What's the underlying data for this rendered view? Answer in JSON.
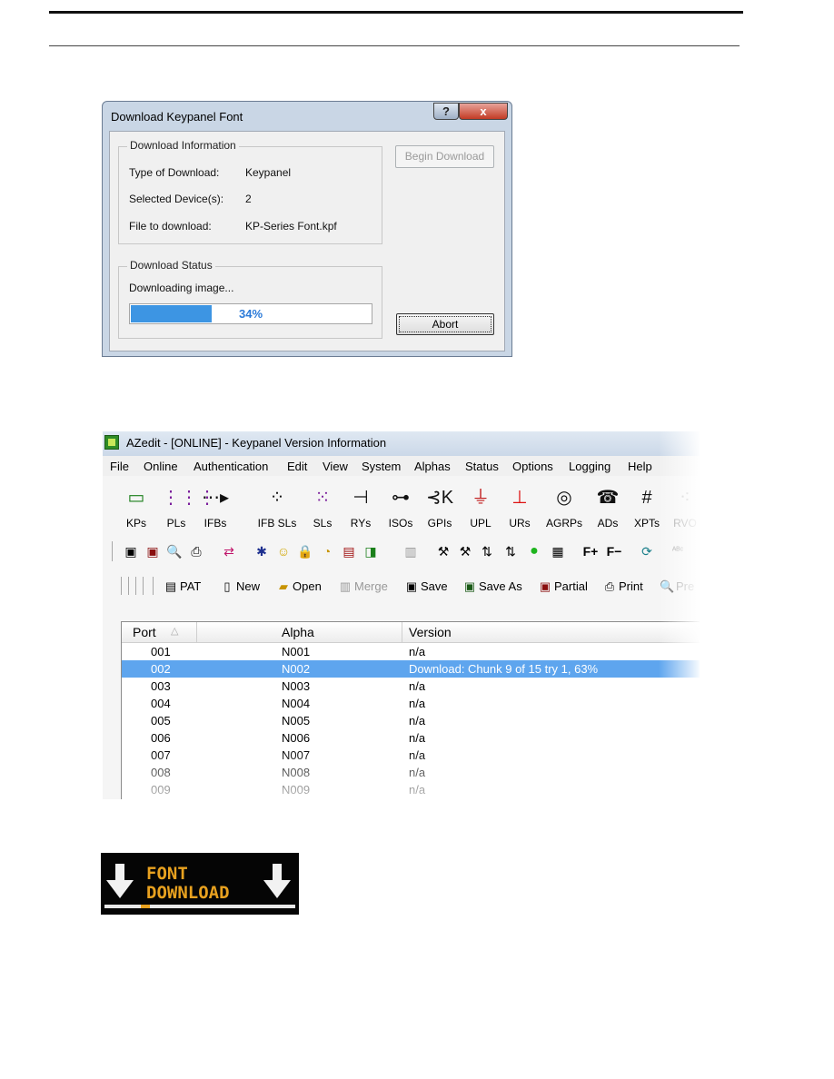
{
  "dialog": {
    "title": "Download Keypanel Font",
    "help_button": "?",
    "close_button": "x",
    "info_group": "Download Information",
    "type_label": "Type of Download:",
    "type_value": "Keypanel",
    "devices_label": "Selected Device(s):",
    "devices_value": "2",
    "file_label": "File to download:",
    "file_value": "KP-Series Font.kpf",
    "begin_button": "Begin Download",
    "status_group": "Download Status",
    "status_text": "Downloading image...",
    "progress_percent": 34,
    "progress_text": "34%",
    "abort_button": "Abort",
    "colors": {
      "progress": "#3d95e3",
      "titlebar": "#c9d6e5"
    }
  },
  "azedit": {
    "title": "AZedit - [ONLINE] - Keypanel Version Information",
    "menu": [
      "File",
      "Online",
      "Authentication",
      "Edit",
      "View",
      "System",
      "Alphas",
      "Status",
      "Options",
      "Logging",
      "Help"
    ],
    "toolbar_main": [
      {
        "label": "KPs",
        "icon": "keypanel-icon"
      },
      {
        "label": "PLs",
        "icon": "party-line-icon"
      },
      {
        "label": "IFBs",
        "icon": "ifb-icon"
      },
      {
        "label": "IFB SLs",
        "icon": "ifb-sl-icon"
      },
      {
        "label": "SLs",
        "icon": "special-list-icon"
      },
      {
        "label": "RYs",
        "icon": "relay-icon"
      },
      {
        "label": "ISOs",
        "icon": "iso-icon"
      },
      {
        "label": "GPIs",
        "icon": "gpi-icon"
      },
      {
        "label": "UPL",
        "icon": "upl-icon"
      },
      {
        "label": "URs",
        "icon": "ur-icon"
      },
      {
        "label": "AGRPs",
        "icon": "agrp-icon"
      },
      {
        "label": "ADs",
        "icon": "ad-icon"
      },
      {
        "label": "XPTs",
        "icon": "crosspoint-icon"
      },
      {
        "label": "RVO",
        "icon": "rvo-icon"
      }
    ],
    "toolbar_file": [
      {
        "label": "PAT",
        "icon": "pat-icon"
      },
      {
        "label": "New",
        "icon": "new-file-icon"
      },
      {
        "label": "Open",
        "icon": "open-folder-icon"
      },
      {
        "label": "Merge",
        "icon": "merge-icon"
      },
      {
        "label": "Save",
        "icon": "save-icon"
      },
      {
        "label": "Save As",
        "icon": "save-as-icon"
      },
      {
        "label": "Partial",
        "icon": "partial-icon"
      },
      {
        "label": "Print",
        "icon": "printer-icon"
      },
      {
        "label": "Pre",
        "icon": "preview-icon"
      }
    ],
    "columns": [
      "Port",
      "Alpha",
      "Version"
    ],
    "rows": [
      {
        "port": "001",
        "alpha": "N001",
        "version": "n/a"
      },
      {
        "port": "002",
        "alpha": "N002",
        "version": "Download: Chunk 9 of 15 try 1, 63%"
      },
      {
        "port": "003",
        "alpha": "N003",
        "version": "n/a"
      },
      {
        "port": "004",
        "alpha": "N004",
        "version": "n/a"
      },
      {
        "port": "005",
        "alpha": "N005",
        "version": "n/a"
      },
      {
        "port": "006",
        "alpha": "N006",
        "version": "n/a"
      },
      {
        "port": "007",
        "alpha": "N007",
        "version": "n/a"
      },
      {
        "port": "008",
        "alpha": "N008",
        "version": "n/a"
      },
      {
        "port": "009",
        "alpha": "N009",
        "version": "n/a"
      }
    ],
    "selected_row": 1,
    "colors": {
      "selection": "#5ea5ee"
    }
  },
  "keypanel_display": {
    "line1": "FONT",
    "line2": "DOWNLOAD",
    "colors": {
      "text": "#e8a11f",
      "background": "#050505"
    }
  }
}
